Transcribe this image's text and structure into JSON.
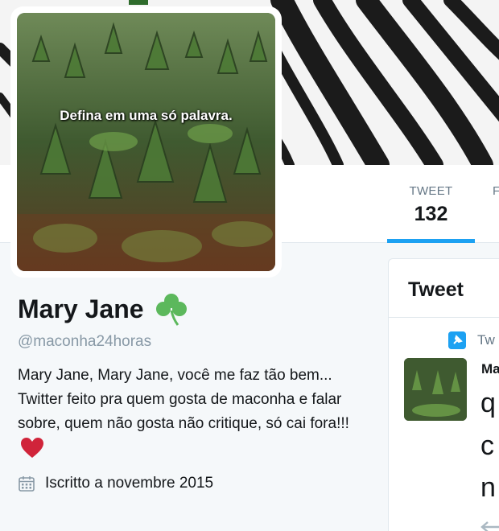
{
  "banner": {
    "pattern": "zebra-stripes"
  },
  "avatar": {
    "caption": "Defina em uma só palavra."
  },
  "nav": {
    "stats": [
      {
        "label": "TWEET",
        "value": "132",
        "active": true
      }
    ],
    "next_stat_label": "F"
  },
  "profile": {
    "name": "Mary Jane",
    "name_emoji": "shamrock-icon",
    "handle": "@maconha24horas",
    "bio": "Mary Jane, Mary Jane, você me faz tão bem... Twitter feito pra quem gosta de maconha e falar sobre, quem não gosta não critique, só cai fora!!!",
    "bio_emoji": "heart-icon",
    "joined": "Iscritto a novembre 2015"
  },
  "timeline": {
    "title": "Tweet",
    "pinned_label": "Tw",
    "author_partial": "Ma",
    "tweet_lines": [
      "q",
      "c",
      "n"
    ]
  },
  "colors": {
    "accent": "#1da1f2",
    "text": "#14171a",
    "muted": "#657786",
    "heart": "#e0245e",
    "shamrock": "#5cb85c"
  }
}
